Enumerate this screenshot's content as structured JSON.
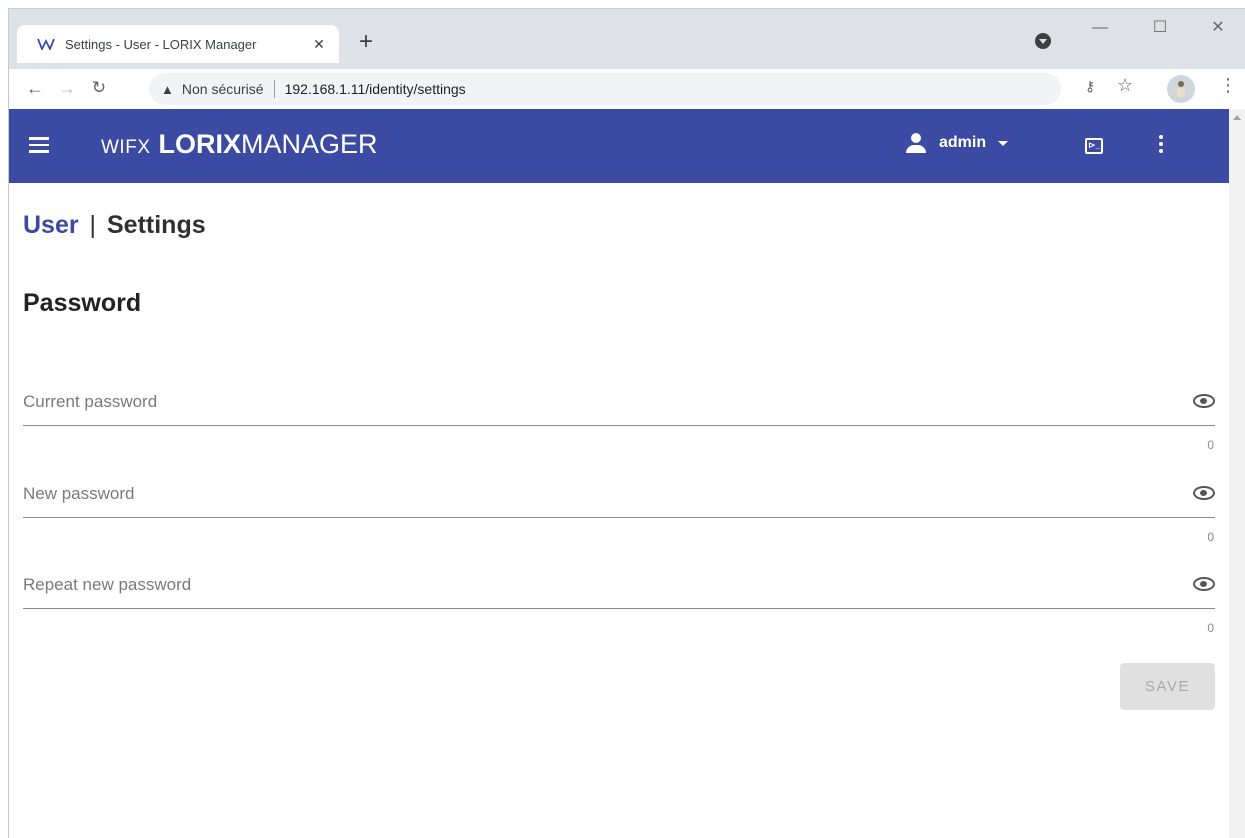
{
  "browser": {
    "tab_title": "Settings - User - LORIX Manager",
    "tab_close": "✕",
    "new_tab": "+",
    "window_min": "—",
    "window_max": "☐",
    "window_close": "✕",
    "back": "←",
    "forward": "→",
    "reload": "↻",
    "security_warning_icon": "▲",
    "security_label": "Non sécurisé",
    "url": "192.168.1.11/identity/settings",
    "key": "⚷",
    "star": "☆",
    "menu": "⋮"
  },
  "appbar": {
    "logo_mark": "WIFX",
    "logo_bold": "LORIX",
    "logo_light": "MANAGER",
    "user": "admin",
    "terminal": "⊳_",
    "color": "#3b4ba3"
  },
  "breadcrumb": {
    "parent": "User",
    "separator": "|",
    "current": "Settings"
  },
  "section": {
    "title": "Password"
  },
  "fields": [
    {
      "label": "Current password",
      "counter": "0"
    },
    {
      "label": "New password",
      "counter": "0"
    },
    {
      "label": "Repeat new password",
      "counter": "0"
    }
  ],
  "actions": {
    "save": "SAVE"
  }
}
